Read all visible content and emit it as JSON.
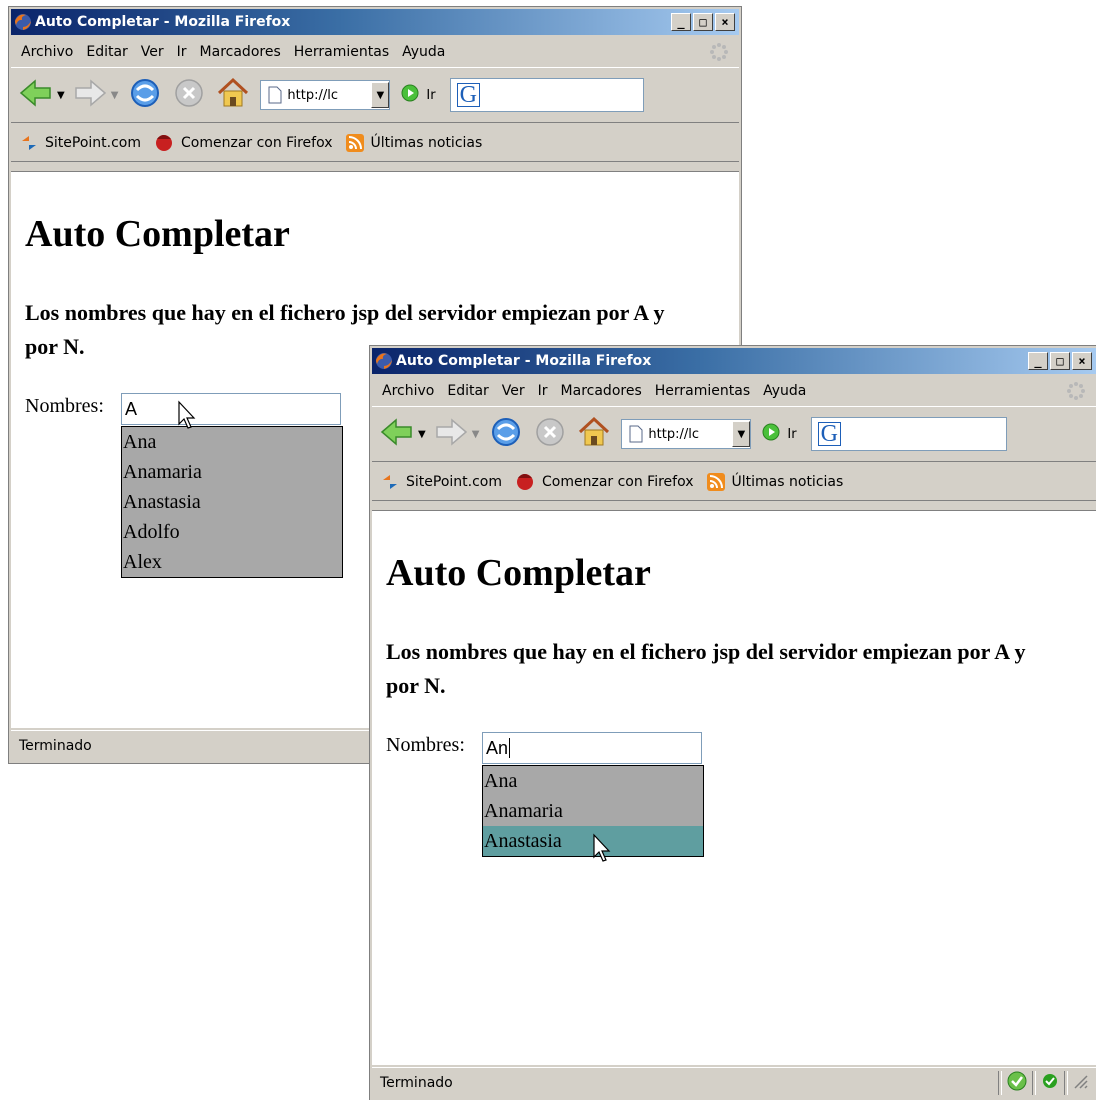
{
  "window1": {
    "title": "Auto Completar - Mozilla Firefox",
    "menu": [
      "Archivo",
      "Editar",
      "Ver",
      "Ir",
      "Marcadores",
      "Herramientas",
      "Ayuda"
    ],
    "url": "http://lc",
    "go_label": "Ir",
    "bookmarks": [
      "SitePoint.com",
      "Comenzar con Firefox",
      "Últimas noticias"
    ],
    "heading": "Auto Completar",
    "subtitle": "Los nombres que hay en el fichero jsp del servidor empiezan por A y por N.",
    "field_label": "Nombres:",
    "input_value": "A",
    "suggestions": [
      "Ana",
      "Anamaria",
      "Anastasia",
      "Adolfo",
      "Alex"
    ],
    "status": "Terminado"
  },
  "window2": {
    "title": "Auto Completar - Mozilla Firefox",
    "menu": [
      "Archivo",
      "Editar",
      "Ver",
      "Ir",
      "Marcadores",
      "Herramientas",
      "Ayuda"
    ],
    "url": "http://lc",
    "go_label": "Ir",
    "bookmarks": [
      "SitePoint.com",
      "Comenzar con Firefox",
      "Últimas noticias"
    ],
    "heading": "Auto Completar",
    "subtitle": "Los nombres que hay en el fichero jsp del servidor empiezan por A y por N.",
    "field_label": "Nombres:",
    "input_value": "An",
    "suggestions": [
      "Ana",
      "Anamaria",
      "Anastasia"
    ],
    "highlighted_suggestion": "Anastasia",
    "status": "Terminado"
  },
  "colors": {
    "suggestion_bg": "#a8a8a8",
    "suggestion_highlight": "#5f9ea0",
    "titlebar_start": "#0a246a",
    "titlebar_end": "#a6caf0"
  }
}
